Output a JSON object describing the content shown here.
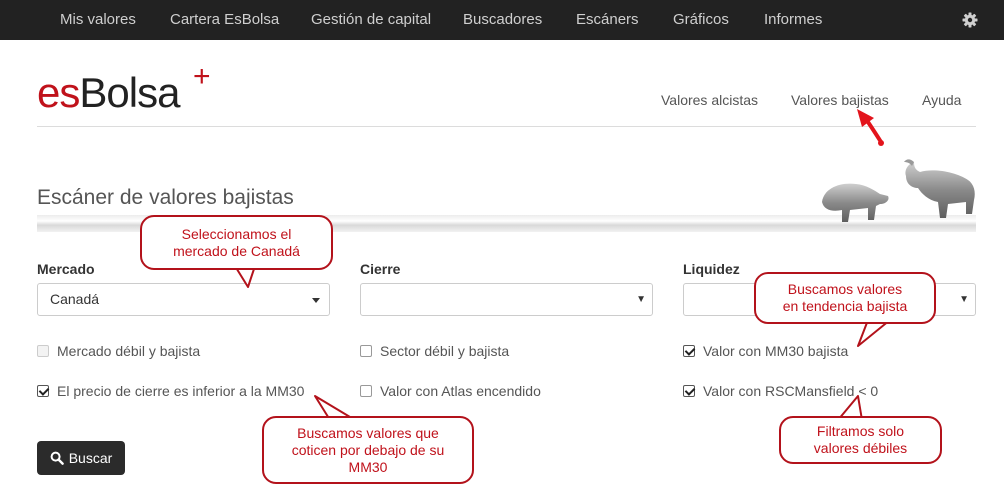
{
  "topnav": {
    "items": [
      "Mis valores",
      "Cartera EsBolsa",
      "Gestión de capital",
      "Buscadores",
      "Escáners",
      "Gráficos",
      "Informes"
    ],
    "settings_icon": "gear-icon"
  },
  "logo": {
    "es": "es",
    "bolsa": "Bolsa",
    "plus": "+"
  },
  "subnav": {
    "items": [
      "Valores alcistas",
      "Valores bajistas",
      "Ayuda"
    ]
  },
  "page": {
    "title": "Escáner de valores bajistas"
  },
  "form": {
    "mercado": {
      "label": "Mercado",
      "value": "Canadá"
    },
    "cierre": {
      "label": "Cierre",
      "value": ""
    },
    "liquidez": {
      "label": "Liquidez",
      "value": ""
    },
    "checks": [
      {
        "label": "Mercado débil y bajista",
        "checked": false,
        "disabled": true
      },
      {
        "label": "Sector débil y bajista",
        "checked": false,
        "disabled": false
      },
      {
        "label": "Valor con MM30 bajista",
        "checked": true,
        "disabled": false
      },
      {
        "label": "El precio de cierre es inferior a la MM30",
        "checked": true,
        "disabled": false
      },
      {
        "label": "Valor con Atlas encendido",
        "checked": false,
        "disabled": false
      },
      {
        "label": "Valor con RSCMansfield < 0",
        "checked": true,
        "disabled": false
      }
    ],
    "search_label": "Buscar"
  },
  "callouts": {
    "mercado": [
      "Seleccionamos el",
      "mercado de Canadá"
    ],
    "tendencia": [
      "Buscamos valores",
      "en tendencia bajista"
    ],
    "mm30": [
      "Buscamos valores que",
      "coticen por debajo de su",
      "MM30"
    ],
    "debiles": [
      "Filtramos solo",
      "valores débiles"
    ]
  },
  "colors": {
    "accent": "#c0121b",
    "topnav_bg": "#222222",
    "button_bg": "#2b2b2b"
  }
}
